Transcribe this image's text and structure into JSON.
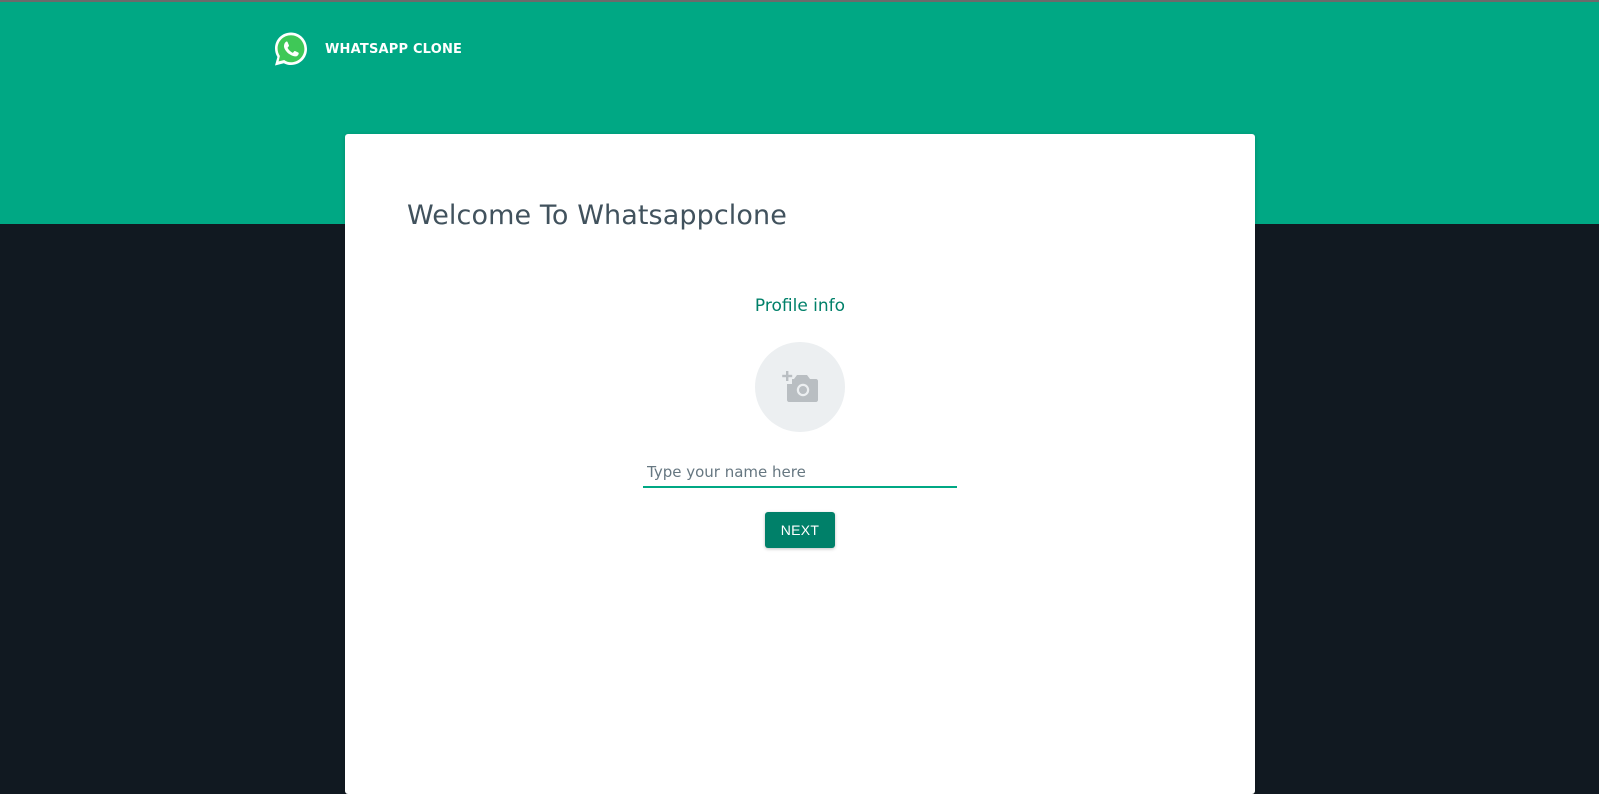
{
  "brand": {
    "name": "WHATSAPP CLONE",
    "logo_icon": "whatsapp-logo-icon"
  },
  "welcome": {
    "title": "Welcome To Whatsappclone"
  },
  "profile": {
    "heading": "Profile info",
    "avatar_icon": "add-photo-camera-icon",
    "name_input": {
      "value": "",
      "placeholder": "Type your name here"
    },
    "next_label": "NEXT"
  },
  "colors": {
    "header": "#00a884",
    "background": "#111921",
    "accent": "#008069",
    "card": "#ffffff"
  }
}
